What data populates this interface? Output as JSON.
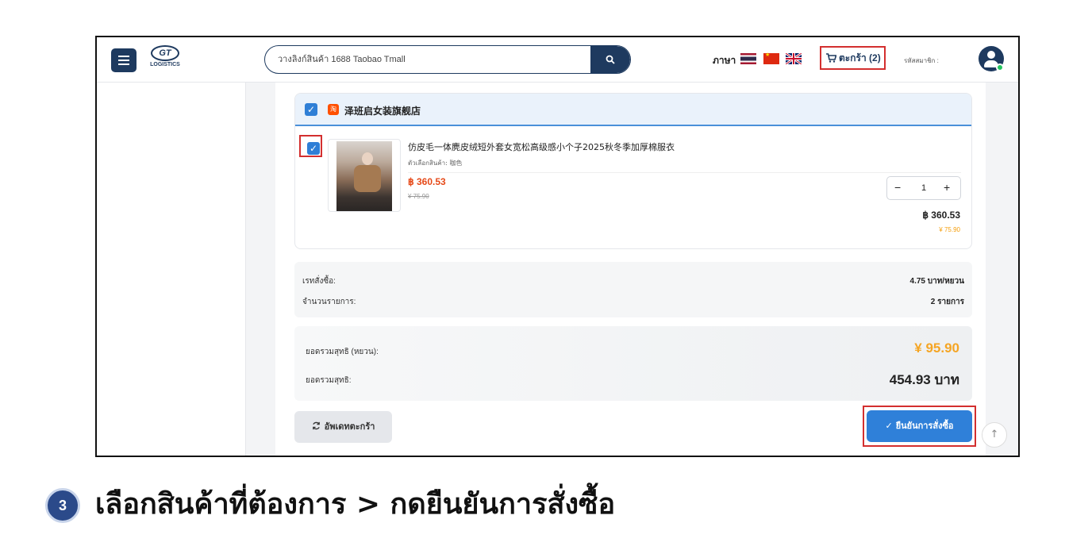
{
  "header": {
    "logo_text": "GT",
    "logo_sub": "LOGISTICS",
    "search_placeholder": "วางลิงก์สินค้า 1688 Taobao Tmall",
    "language_label": "ภาษา",
    "cart_label": "ตะกร้า (2)",
    "member_label": "รหัสสมาชิก :"
  },
  "shop": {
    "name": "泽班启女装旗舰店",
    "platform_icon": "淘"
  },
  "product": {
    "title": "仿皮毛一体麂皮绒短外套女宽松高级感小个子2025秋冬季加厚棉服衣",
    "option": "ตัวเลือกสินค้า: 咖色",
    "price_thb": "฿ 360.53",
    "price_cny_old": "¥ 75.90",
    "quantity": "1",
    "line_total_thb": "฿ 360.53",
    "line_total_cny": "¥ 75.90"
  },
  "summary": {
    "rate_label": "เรทสั่งซื้อ:",
    "rate_value": "4.75 บาท/หยวน",
    "items_label": "จำนวนรายการ:",
    "items_value": "2 รายการ",
    "net_cny_label": "ยอดรวมสุทธิ (หยวน):",
    "net_cny_value": "¥ 95.90",
    "net_thb_label": "ยอดรวมสุทธิ:",
    "net_thb_value": "454.93 บาท"
  },
  "actions": {
    "refresh_label": "อัพเดทตะกร้า",
    "confirm_label": "ยืนยันการสั่งซื้อ"
  },
  "tutorial": {
    "step_number": "3",
    "caption": "เลือกสินค้าที่ต้องการ > กดยืนยันการสั่งซื้อ"
  },
  "colors": {
    "brand_navy": "#1e3a5f",
    "confirm_blue": "#2f80d9",
    "highlight_red": "#d32f2f",
    "cny_orange": "#f5a524"
  }
}
